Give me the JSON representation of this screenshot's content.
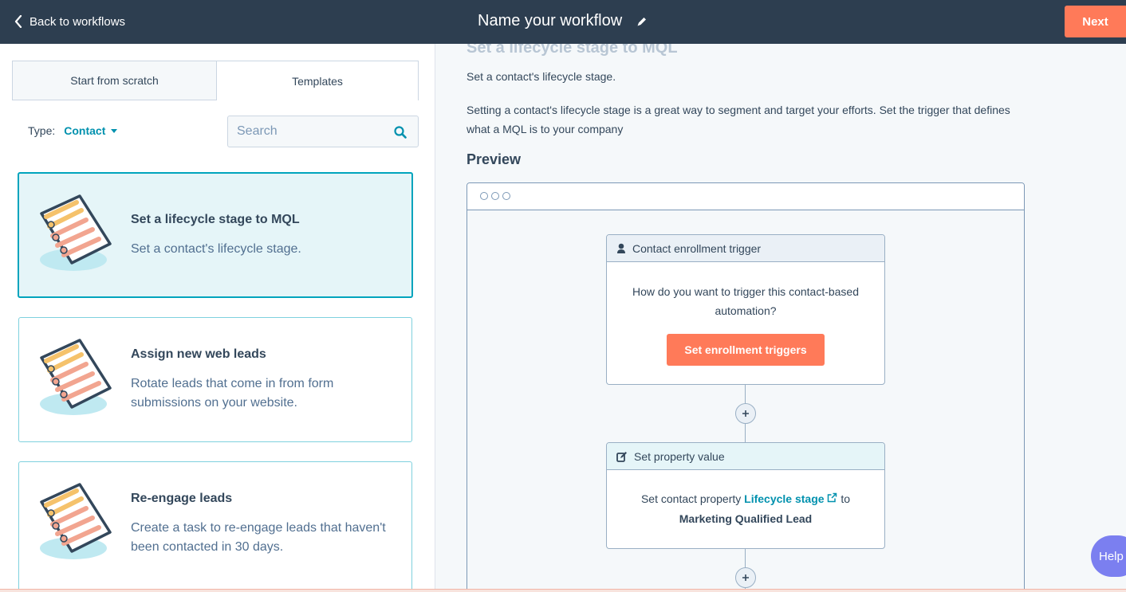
{
  "header": {
    "back_label": "Back to workflows",
    "workflow_name": "Name your workflow",
    "next_label": "Next"
  },
  "left_panel": {
    "tabs": [
      {
        "label": "Start from scratch",
        "active": false
      },
      {
        "label": "Templates",
        "active": true
      }
    ],
    "type_label": "Type:",
    "type_value": "Contact",
    "search_placeholder": "Search",
    "templates": [
      {
        "title": "Set a lifecycle stage to MQL",
        "description": "Set a contact's lifecycle stage.",
        "selected": true
      },
      {
        "title": "Assign new web leads",
        "description": "Rotate leads that come in from form submissions on your website.",
        "selected": false
      },
      {
        "title": "Re-engage leads",
        "description": "Create a task to re-engage leads that haven't been contacted in 30 days.",
        "selected": false
      }
    ]
  },
  "right_panel": {
    "heading": "Set a lifecycle stage to MQL",
    "description_short": "Set a contact's lifecycle stage.",
    "description_long": "Setting a contact's lifecycle stage is a great way to segment and target your efforts. Set the trigger that defines what a MQL is to your company",
    "preview_label": "Preview",
    "trigger_node": {
      "title": "Contact enrollment trigger",
      "question": "How do you want to trigger this contact-based automation?",
      "button_label": "Set enrollment triggers"
    },
    "action_node": {
      "title": "Set property value",
      "text_prefix": "Set contact property",
      "property_link": "Lifecycle stage",
      "text_to": "to",
      "value": "Marketing Qualified Lead"
    }
  },
  "help_label": "Help",
  "colors": {
    "topbar": "#2d3e50",
    "accent_orange": "#ff7a59",
    "link_teal": "#0091ae",
    "selected_border": "#00a4bd",
    "help_purple": "#7b7ff0"
  }
}
